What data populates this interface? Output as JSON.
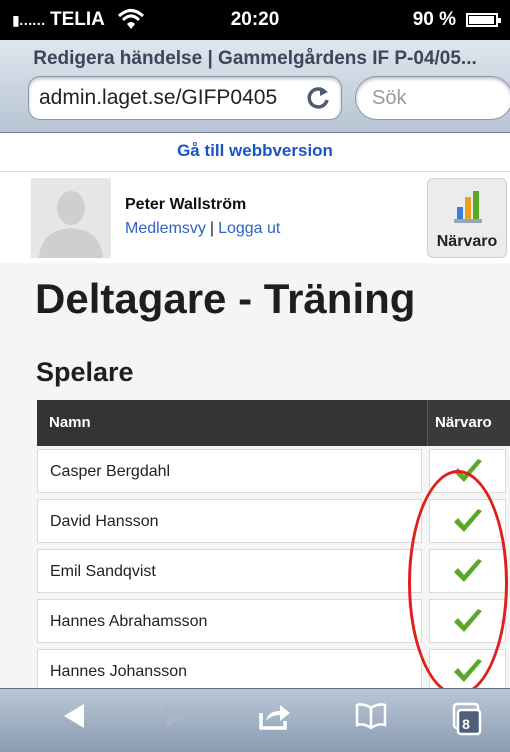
{
  "status_bar": {
    "carrier": "TELIA",
    "signal": "▮……",
    "time": "20:20",
    "battery": "90 %"
  },
  "browser": {
    "page_title": "Redigera händelse | Gammelgårdens IF P-04/05...",
    "url": "admin.laget.se/GIFP0405",
    "search_placeholder": "Sök"
  },
  "web_version_link": "Gå till webbversion",
  "user": {
    "name": "Peter Wallström",
    "member_view": "Medlemsvy",
    "separator": "|",
    "logout": "Logga ut"
  },
  "attendance_button": {
    "label": "Närvaro"
  },
  "page": {
    "heading": "Deltagare - Träning",
    "section": "Spelare"
  },
  "table": {
    "columns": [
      "Namn",
      "Närvaro"
    ],
    "rows": [
      {
        "name": "Casper Bergdahl",
        "present": true
      },
      {
        "name": "David Hansson",
        "present": true
      },
      {
        "name": "Emil Sandqvist",
        "present": true
      },
      {
        "name": "Hannes Abrahamsson",
        "present": true
      },
      {
        "name": "Hannes Johansson",
        "present": true
      }
    ]
  },
  "colors": {
    "check": "#5aa82a",
    "highlight": "#e0201c",
    "link": "#1a55c6",
    "table_header": "#333333"
  },
  "toolbar": {
    "back_icon": "back-arrow-icon",
    "forward_icon": "forward-arrow-icon",
    "share_icon": "share-icon",
    "bookmarks_icon": "bookmarks-icon",
    "tabs_count": "8"
  }
}
